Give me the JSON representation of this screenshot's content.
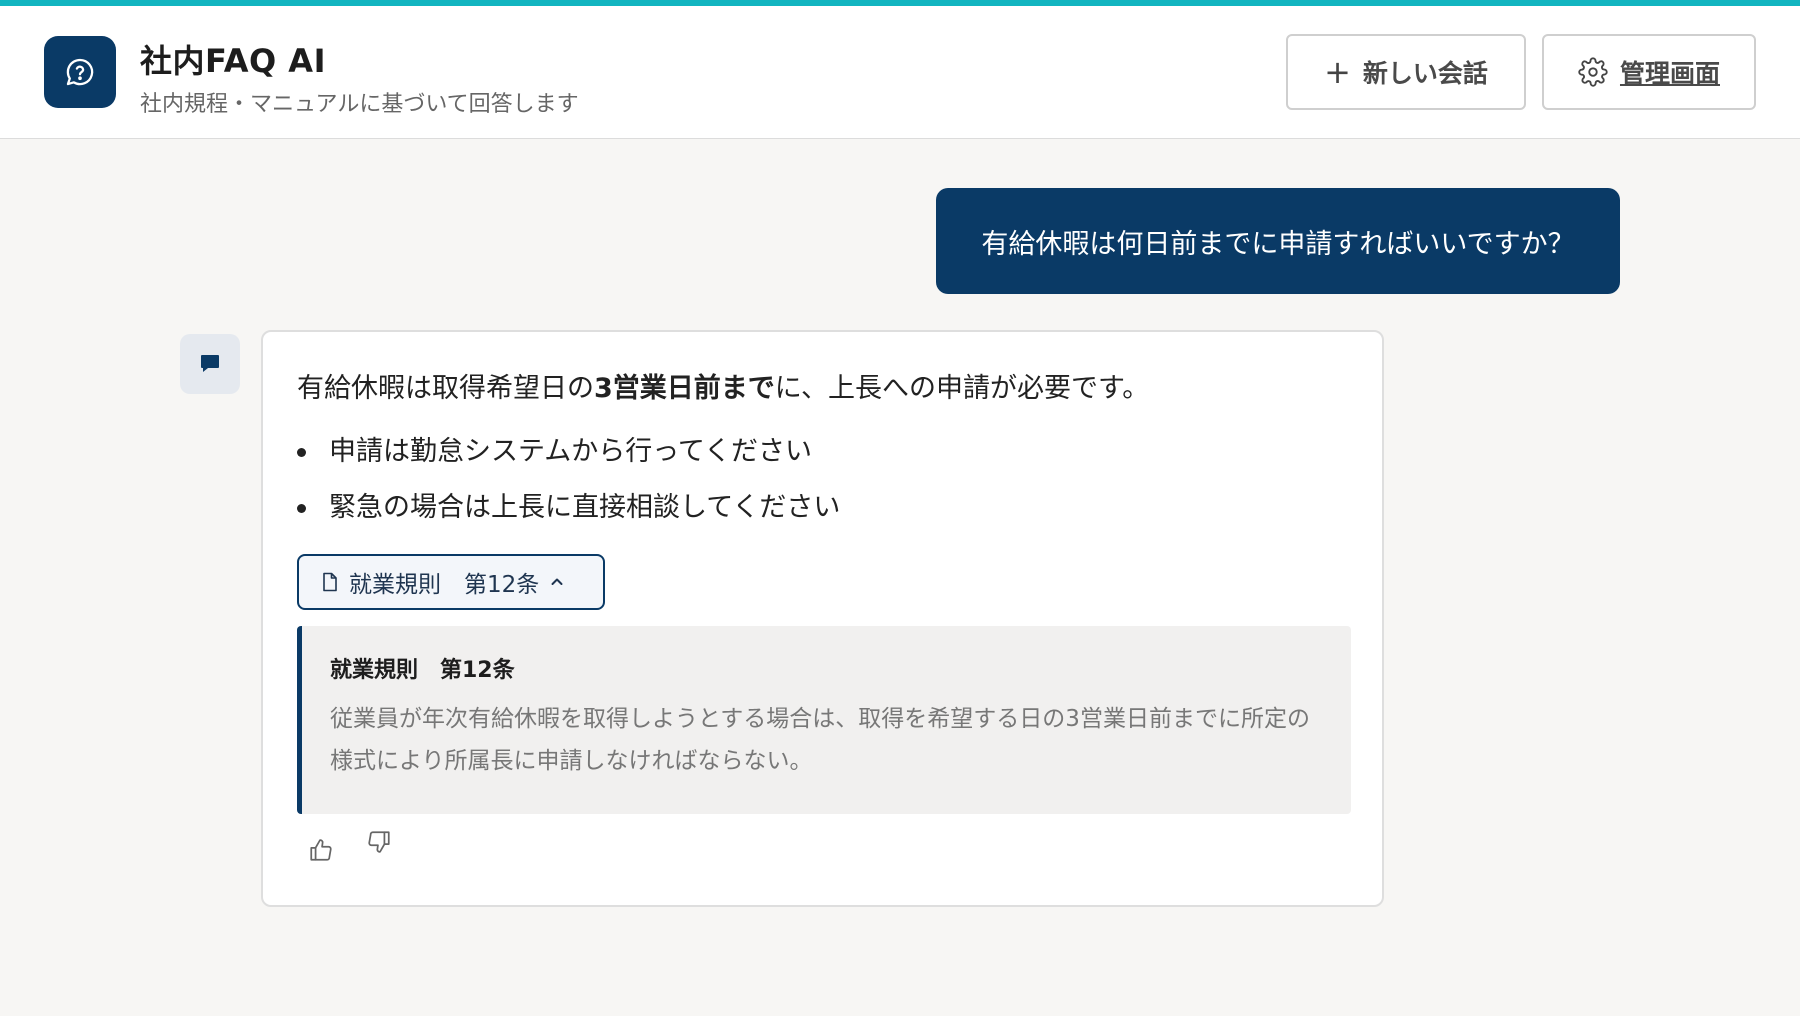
{
  "header": {
    "title": "社内FAQ AI",
    "subtitle": "社内規程・マニュアルに基づいて回答します",
    "new_chat_label": "新しい会話",
    "admin_label": "管理画面",
    "logo_icon": "chat-question-icon"
  },
  "colors": {
    "accent_bar": "#12b5c0",
    "brand": "#0a3a66",
    "page_bg": "#f7f6f4"
  },
  "conversation": {
    "user_message": "有給休暇は何日前までに申請すればいいですか？",
    "bot": {
      "answer_prefix": "有給休暇は取得希望日の",
      "answer_bold": "3営業日前まで",
      "answer_suffix": "に、上長への申請が必要です。",
      "bullets": [
        "申請は勤怠システムから行ってください",
        "緊急の場合は上長に直接相談してください"
      ],
      "source_chip_label": "就業規則　第12条",
      "source": {
        "title": "就業規則　第12条",
        "text": "従業員が年次有給休暇を取得しようとする場合は、取得を希望する日の3営業日前までに所定の様式により所属長に申請しなければならない。"
      },
      "feedback": {
        "up_icon": "thumbs-up-icon",
        "down_icon": "thumbs-down-icon"
      }
    }
  }
}
